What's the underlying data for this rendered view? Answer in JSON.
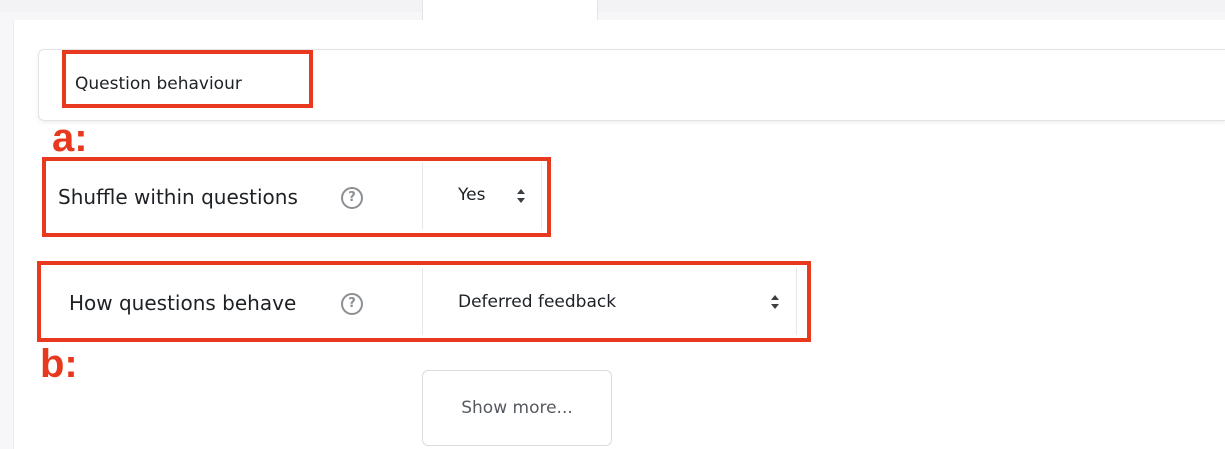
{
  "section": {
    "title": "Question behaviour"
  },
  "annotations": {
    "a": "a:",
    "b": "b:",
    "color": "#e8391f"
  },
  "fields": {
    "shuffle": {
      "label": "Shuffle within questions",
      "help_icon": "help-icon",
      "help_glyph": "?",
      "value": "Yes"
    },
    "behave": {
      "label": "How questions behave",
      "help_icon": "help-icon",
      "help_glyph": "?",
      "value": "Deferred feedback"
    }
  },
  "show_more": {
    "label": "Show more..."
  }
}
